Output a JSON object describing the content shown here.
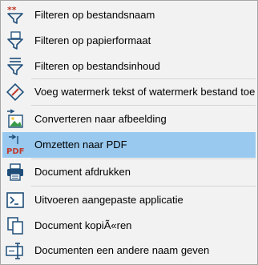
{
  "menu": {
    "items": [
      {
        "label": "Filteren op bestandsnaam",
        "icon": "funnel-asterisk-icon"
      },
      {
        "label": "Filteren op papierformaat",
        "icon": "funnel-paper-icon"
      },
      {
        "label": "Filteren op bestandsinhoud",
        "icon": "funnel-lines-icon"
      },
      {
        "label": "Voeg watermerk tekst of watermerk bestand toe",
        "icon": "watermark-icon"
      },
      {
        "label": "Converteren naar afbeelding",
        "icon": "convert-image-icon"
      },
      {
        "label": "Omzetten naar PDF",
        "icon": "convert-pdf-icon",
        "pdf_text": "PDF"
      },
      {
        "label": "Document afdrukken",
        "icon": "printer-icon"
      },
      {
        "label": "Uitvoeren aangepaste applicatie",
        "icon": "terminal-icon"
      },
      {
        "label": "Document kopiÃ«ren",
        "icon": "copy-document-icon"
      },
      {
        "label": "Documenten een andere naam geven",
        "icon": "rename-icon"
      }
    ],
    "highlighted_item": "Omzetten naar PDF"
  },
  "colors": {
    "menu_background": "#f2f2f2",
    "highlight": "#99c9ef",
    "icon_primary": "#1f4e79",
    "icon_accent": "#c0392b",
    "separator": "#d5d5d5"
  }
}
